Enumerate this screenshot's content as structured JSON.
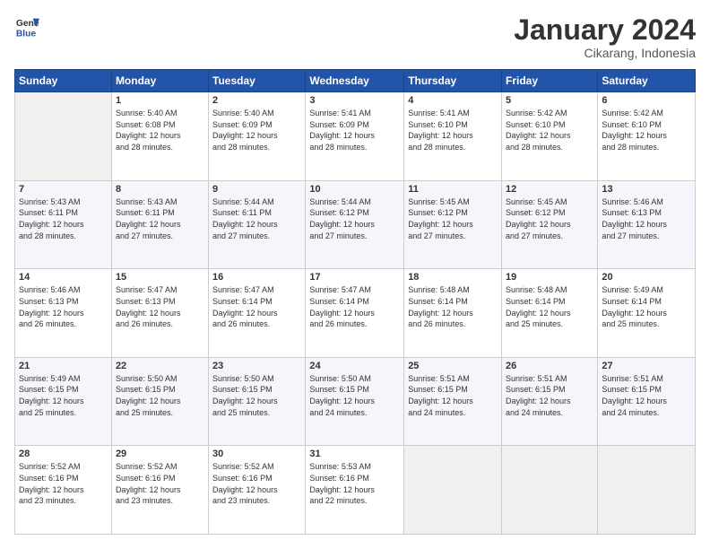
{
  "header": {
    "logo_line1": "General",
    "logo_line2": "Blue",
    "month": "January 2024",
    "location": "Cikarang, Indonesia"
  },
  "weekdays": [
    "Sunday",
    "Monday",
    "Tuesday",
    "Wednesday",
    "Thursday",
    "Friday",
    "Saturday"
  ],
  "weeks": [
    [
      {
        "num": "",
        "info": ""
      },
      {
        "num": "1",
        "info": "Sunrise: 5:40 AM\nSunset: 6:08 PM\nDaylight: 12 hours\nand 28 minutes."
      },
      {
        "num": "2",
        "info": "Sunrise: 5:40 AM\nSunset: 6:09 PM\nDaylight: 12 hours\nand 28 minutes."
      },
      {
        "num": "3",
        "info": "Sunrise: 5:41 AM\nSunset: 6:09 PM\nDaylight: 12 hours\nand 28 minutes."
      },
      {
        "num": "4",
        "info": "Sunrise: 5:41 AM\nSunset: 6:10 PM\nDaylight: 12 hours\nand 28 minutes."
      },
      {
        "num": "5",
        "info": "Sunrise: 5:42 AM\nSunset: 6:10 PM\nDaylight: 12 hours\nand 28 minutes."
      },
      {
        "num": "6",
        "info": "Sunrise: 5:42 AM\nSunset: 6:10 PM\nDaylight: 12 hours\nand 28 minutes."
      }
    ],
    [
      {
        "num": "7",
        "info": "Sunrise: 5:43 AM\nSunset: 6:11 PM\nDaylight: 12 hours\nand 28 minutes."
      },
      {
        "num": "8",
        "info": "Sunrise: 5:43 AM\nSunset: 6:11 PM\nDaylight: 12 hours\nand 27 minutes."
      },
      {
        "num": "9",
        "info": "Sunrise: 5:44 AM\nSunset: 6:11 PM\nDaylight: 12 hours\nand 27 minutes."
      },
      {
        "num": "10",
        "info": "Sunrise: 5:44 AM\nSunset: 6:12 PM\nDaylight: 12 hours\nand 27 minutes."
      },
      {
        "num": "11",
        "info": "Sunrise: 5:45 AM\nSunset: 6:12 PM\nDaylight: 12 hours\nand 27 minutes."
      },
      {
        "num": "12",
        "info": "Sunrise: 5:45 AM\nSunset: 6:12 PM\nDaylight: 12 hours\nand 27 minutes."
      },
      {
        "num": "13",
        "info": "Sunrise: 5:46 AM\nSunset: 6:13 PM\nDaylight: 12 hours\nand 27 minutes."
      }
    ],
    [
      {
        "num": "14",
        "info": "Sunrise: 5:46 AM\nSunset: 6:13 PM\nDaylight: 12 hours\nand 26 minutes."
      },
      {
        "num": "15",
        "info": "Sunrise: 5:47 AM\nSunset: 6:13 PM\nDaylight: 12 hours\nand 26 minutes."
      },
      {
        "num": "16",
        "info": "Sunrise: 5:47 AM\nSunset: 6:14 PM\nDaylight: 12 hours\nand 26 minutes."
      },
      {
        "num": "17",
        "info": "Sunrise: 5:47 AM\nSunset: 6:14 PM\nDaylight: 12 hours\nand 26 minutes."
      },
      {
        "num": "18",
        "info": "Sunrise: 5:48 AM\nSunset: 6:14 PM\nDaylight: 12 hours\nand 26 minutes."
      },
      {
        "num": "19",
        "info": "Sunrise: 5:48 AM\nSunset: 6:14 PM\nDaylight: 12 hours\nand 25 minutes."
      },
      {
        "num": "20",
        "info": "Sunrise: 5:49 AM\nSunset: 6:14 PM\nDaylight: 12 hours\nand 25 minutes."
      }
    ],
    [
      {
        "num": "21",
        "info": "Sunrise: 5:49 AM\nSunset: 6:15 PM\nDaylight: 12 hours\nand 25 minutes."
      },
      {
        "num": "22",
        "info": "Sunrise: 5:50 AM\nSunset: 6:15 PM\nDaylight: 12 hours\nand 25 minutes."
      },
      {
        "num": "23",
        "info": "Sunrise: 5:50 AM\nSunset: 6:15 PM\nDaylight: 12 hours\nand 25 minutes."
      },
      {
        "num": "24",
        "info": "Sunrise: 5:50 AM\nSunset: 6:15 PM\nDaylight: 12 hours\nand 24 minutes."
      },
      {
        "num": "25",
        "info": "Sunrise: 5:51 AM\nSunset: 6:15 PM\nDaylight: 12 hours\nand 24 minutes."
      },
      {
        "num": "26",
        "info": "Sunrise: 5:51 AM\nSunset: 6:15 PM\nDaylight: 12 hours\nand 24 minutes."
      },
      {
        "num": "27",
        "info": "Sunrise: 5:51 AM\nSunset: 6:15 PM\nDaylight: 12 hours\nand 24 minutes."
      }
    ],
    [
      {
        "num": "28",
        "info": "Sunrise: 5:52 AM\nSunset: 6:16 PM\nDaylight: 12 hours\nand 23 minutes."
      },
      {
        "num": "29",
        "info": "Sunrise: 5:52 AM\nSunset: 6:16 PM\nDaylight: 12 hours\nand 23 minutes."
      },
      {
        "num": "30",
        "info": "Sunrise: 5:52 AM\nSunset: 6:16 PM\nDaylight: 12 hours\nand 23 minutes."
      },
      {
        "num": "31",
        "info": "Sunrise: 5:53 AM\nSunset: 6:16 PM\nDaylight: 12 hours\nand 22 minutes."
      },
      {
        "num": "",
        "info": ""
      },
      {
        "num": "",
        "info": ""
      },
      {
        "num": "",
        "info": ""
      }
    ]
  ]
}
